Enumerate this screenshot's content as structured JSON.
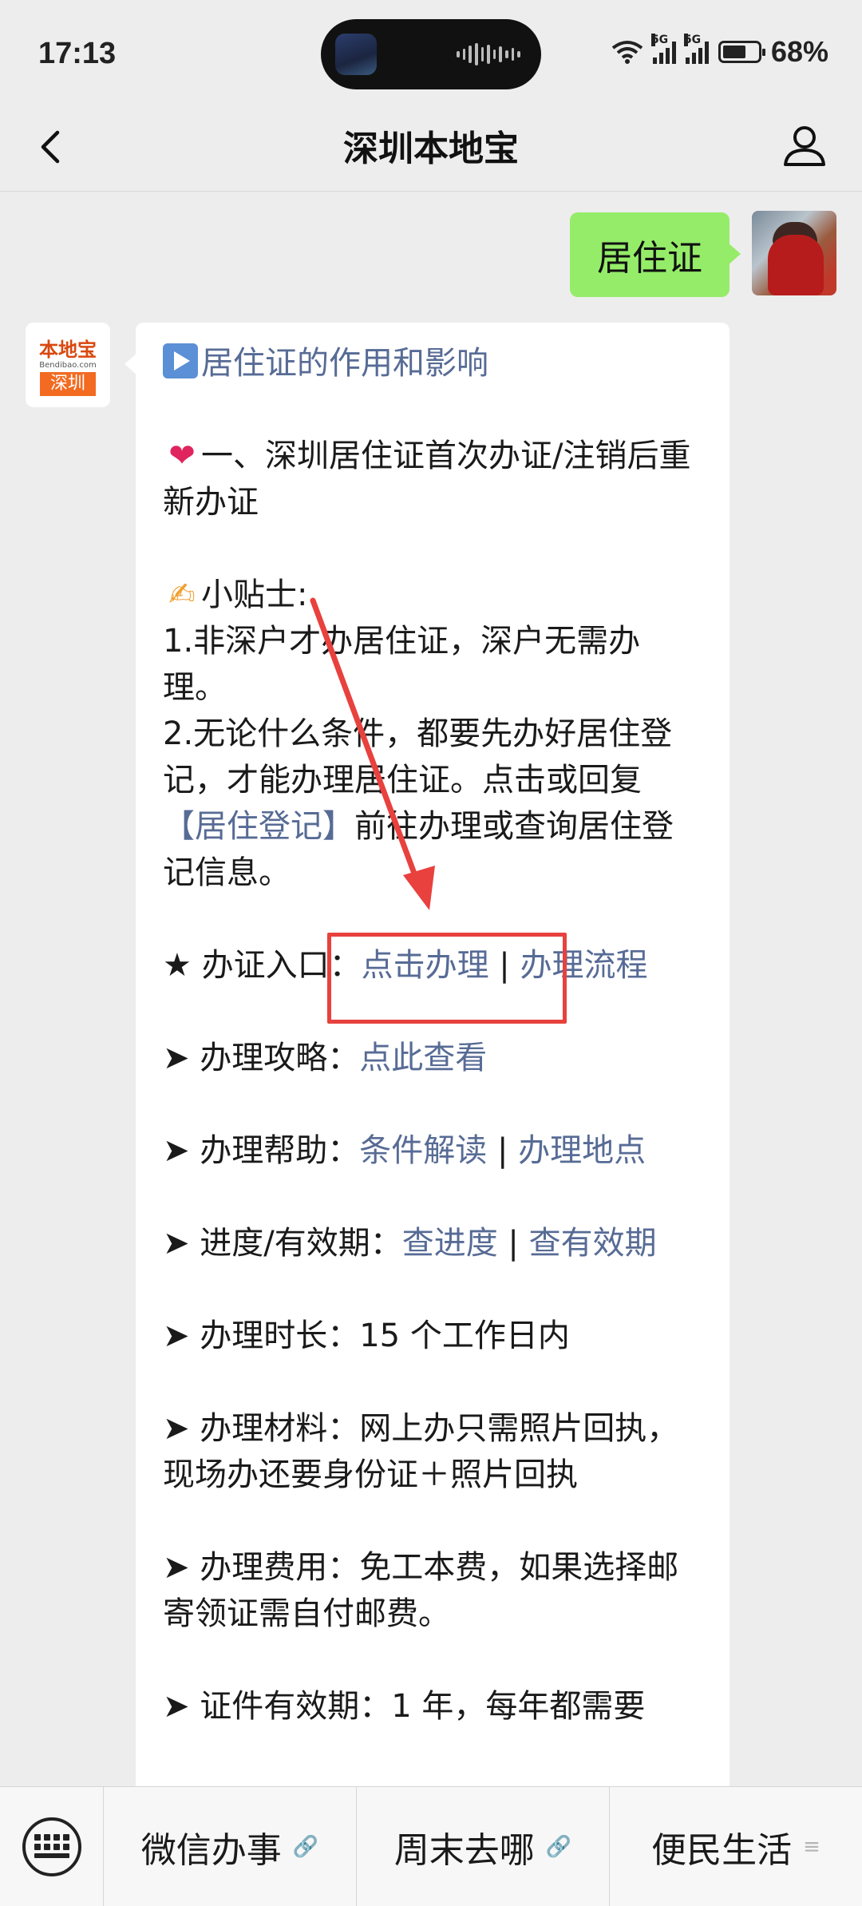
{
  "status_bar": {
    "time": "17:13",
    "network_1": "5G",
    "network_2": "5G",
    "battery_percent": "68%",
    "battery_level": 0.68
  },
  "nav": {
    "title": "深圳本地宝",
    "back_icon": "chevron-left-icon",
    "profile_icon": "person-icon"
  },
  "user_message": {
    "text": "居住证"
  },
  "bot": {
    "avatar": {
      "brand": "本地宝",
      "url": "Bendibao.com",
      "city": "深圳"
    },
    "message": {
      "title_link": "居住证的作用和影响",
      "heading": "一、深圳居住证首次办证/注销后重新办证",
      "tips_label": "小贴士:",
      "tip1": "1.非深户才办居住证，深户无需办理。",
      "tip2_pre": "2.无论什么条件，都要先办好居住登记，才能办理居住证。点击或回复",
      "tip2_link": "【居住登记】",
      "tip2_post": "前往办理或查询居住登记信息。",
      "entry_label": "★ 办证入口：",
      "entry_link1": "点击办理",
      "separator": " | ",
      "entry_link2": "办理流程",
      "guide_label": "➤ 办理攻略：",
      "guide_link": "点此查看",
      "help_label": "➤ 办理帮助：",
      "help_link1": "条件解读",
      "help_link2": "办理地点",
      "progress_label": "➤ 进度/有效期：",
      "progress_link1": "查进度",
      "progress_link2": "查有效期",
      "duration": "➤ 办理时长：15 个工作日内",
      "materials": "➤ 办理材料：网上办只需照片回执，现场办还要身份证＋照片回执",
      "fees": "➤ 办理费用：免工本费，如果选择邮寄领证需自付邮费。",
      "validity": "➤ 证件有效期：1 年，每年都需要"
    }
  },
  "bottom_menu": {
    "keyboard_icon": "keyboard-icon",
    "items": [
      {
        "label": "微信办事",
        "suffix": "🔗"
      },
      {
        "label": "周末去哪",
        "suffix": "🔗"
      },
      {
        "label": "便民生活",
        "suffix": "≡"
      }
    ]
  },
  "colors": {
    "background": "#ededed",
    "user_bubble": "#95ec69",
    "link": "#576b95",
    "annotation_red": "#e8413e"
  }
}
